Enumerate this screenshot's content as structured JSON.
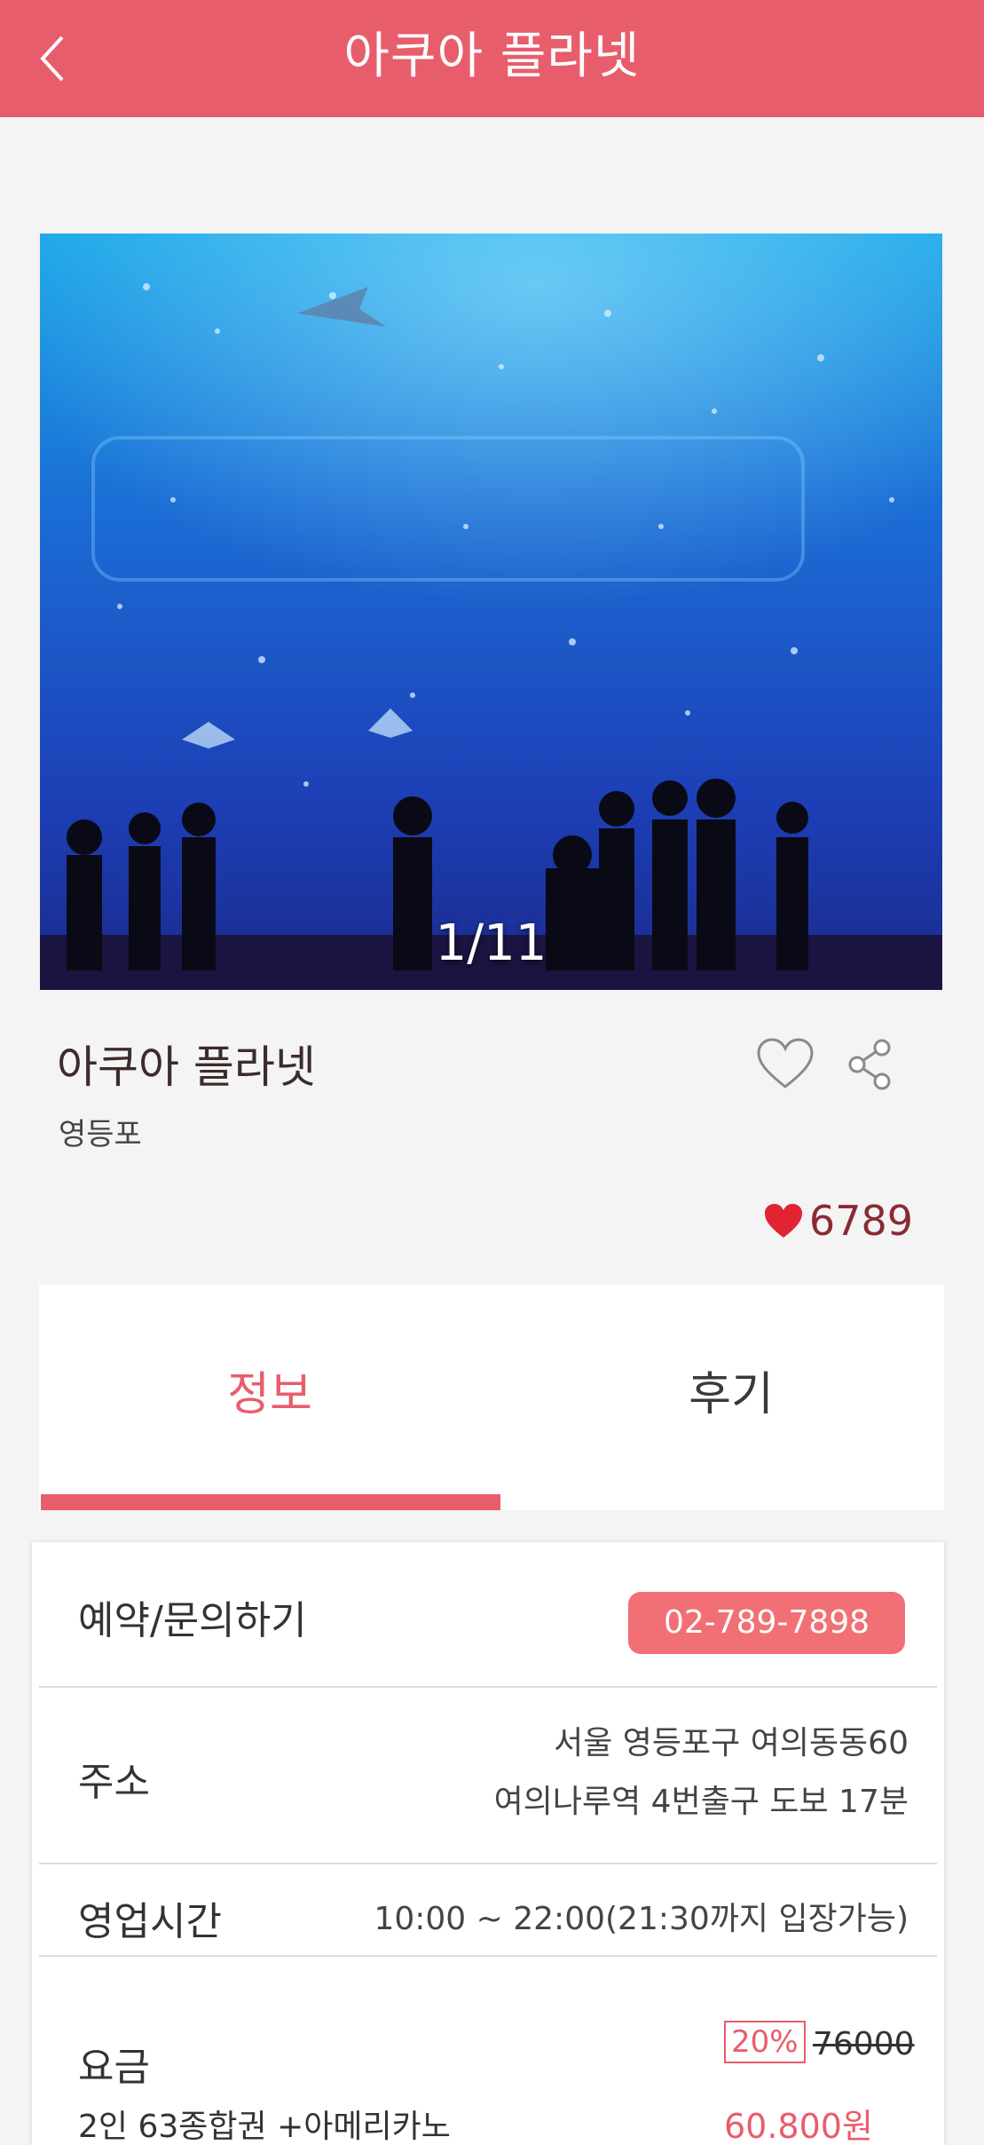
{
  "header": {
    "title": "아쿠아 플라넷"
  },
  "gallery": {
    "counter": "1/11"
  },
  "place": {
    "name": "아쿠아 플라넷",
    "area": "영등포",
    "likes": "6789"
  },
  "tabs": [
    {
      "label": "정보"
    },
    {
      "label": "후기"
    }
  ],
  "info": {
    "reservation": {
      "label": "예약/문의하기",
      "phone": "02-789-7898"
    },
    "address": {
      "label": "주소",
      "line1": "서울 영등포구 여의동동60",
      "line2": "여의나루역 4번출구 도보 17분"
    },
    "hours": {
      "label": "영업시간",
      "value": "10:00 ~ 22:00(21:30까지 입장가능)"
    },
    "price": {
      "label": "요금",
      "description": "2인 63종합권 +아메리카노",
      "discount": "20%",
      "original": "76000",
      "final": "60.800원"
    }
  },
  "colors": {
    "accent": "#e85d6c",
    "button": "#f07076",
    "likes": "#8a2a33"
  }
}
